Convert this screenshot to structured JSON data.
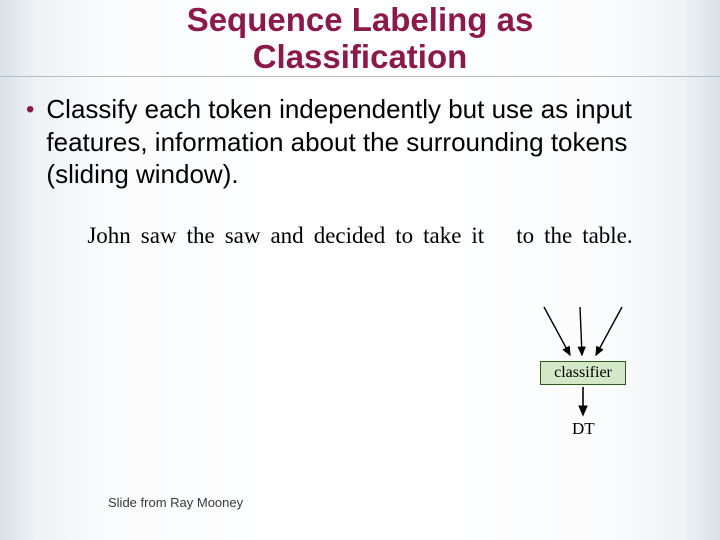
{
  "title_line1": "Sequence Labeling as",
  "title_line2": "Classification",
  "bullet": "Classify each token independently but use as input features, information about the surrounding tokens (sliding window).",
  "sentence": [
    "John",
    "saw",
    "the",
    "saw",
    "and",
    "decided",
    "to",
    "take",
    "it",
    "to",
    "the",
    "table."
  ],
  "classifier_label": "classifier",
  "output_label": "DT",
  "footer": "Slide from Ray Mooney"
}
